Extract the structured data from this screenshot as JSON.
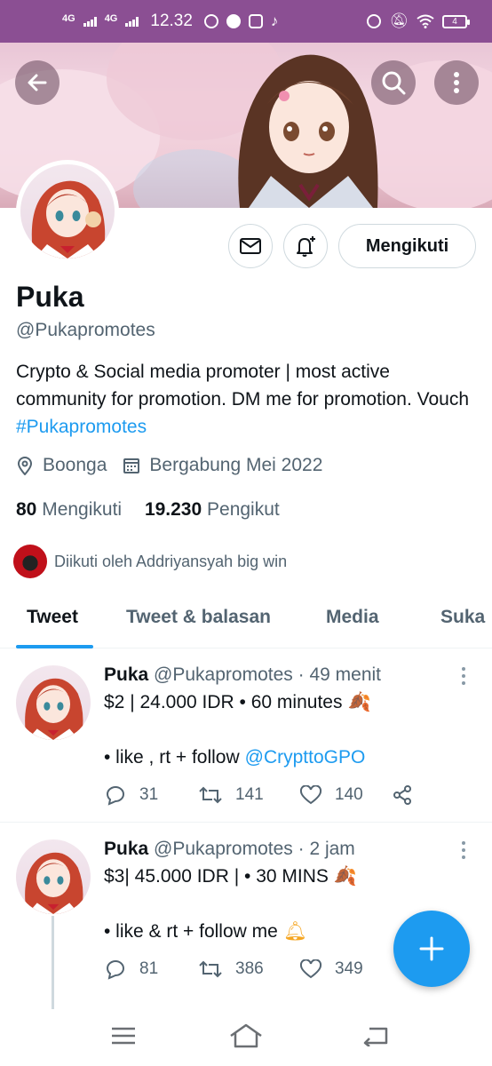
{
  "status_bar": {
    "time": "12.32",
    "network_1": "4G",
    "network_2": "4G",
    "battery": "4",
    "icons": [
      "whatsapp-icon",
      "app-icon",
      "bear-icon",
      "tiktok-icon",
      "alarm-icon",
      "mute-icon",
      "wifi-icon"
    ]
  },
  "header": {
    "back_icon": "arrow-left-icon",
    "search_icon": "search-icon",
    "more_icon": "more-vertical-icon"
  },
  "profile": {
    "name": "Puka",
    "handle": "@Pukapromotes",
    "bio_text": "Crypto & Social media promoter | most active community for promotion. DM me for promotion. Vouch ",
    "bio_hashtag": "#Pukapromotes",
    "location": "Boonga",
    "joined": "Bergabung Mei 2022",
    "following_count": "80",
    "following_label": "Mengikuti",
    "followers_count": "19.230",
    "followers_label": "Pengikut",
    "followed_by": "Diikuti oleh Addriyansyah big win",
    "follow_button": "Mengikuti"
  },
  "tabs": [
    "Tweet",
    "Tweet & balasan",
    "Media",
    "Suka"
  ],
  "tweets": [
    {
      "name": "Puka",
      "handle": "@Pukapromotes",
      "time": "· 49 menit",
      "line1": "$2 | 24.000 IDR • 60 minutes",
      "line2_prefix": "• like , rt + follow ",
      "line2_mention": "@CrypttoGPO",
      "replies": "31",
      "retweets": "141",
      "likes": "140"
    },
    {
      "name": "Puka",
      "handle": "@Pukapromotes",
      "time": "· 2 jam",
      "line1": "$3| 45.000 IDR | • 30 MINS",
      "line2": "• like & rt + follow me",
      "replies": "81",
      "retweets": "386",
      "likes": "349"
    }
  ],
  "colors": {
    "accent": "#1d9bf0",
    "status_bar": "#8b4f93",
    "text": "#0f1419",
    "secondary_text": "#536471"
  }
}
